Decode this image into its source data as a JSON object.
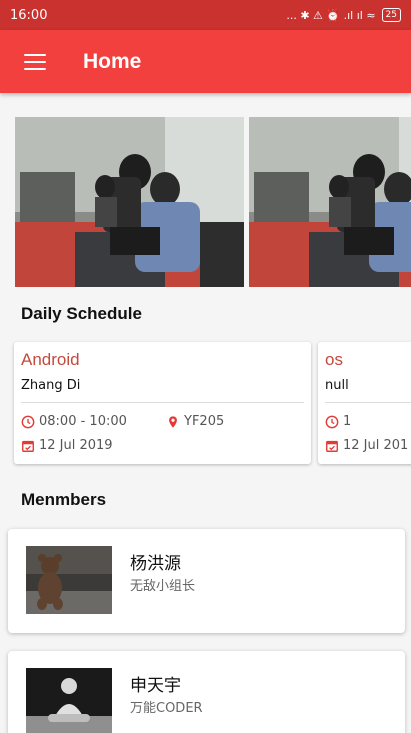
{
  "status_bar": {
    "time": "16:00",
    "indicators": "... ✱ ⚠ ⏰ .ıl ıl ≈",
    "battery": "25"
  },
  "app_bar": {
    "menu_icon": "hamburger-icon",
    "title": "Home"
  },
  "carousel": {
    "images": [
      {
        "description": "photo-two-men-at-laptop"
      },
      {
        "description": "photo-two-men-at-laptop"
      }
    ]
  },
  "schedule": {
    "title": "Daily Schedule",
    "cards": [
      {
        "subject": "Android",
        "teacher": "Zhang Di",
        "time": "08:00 - 10:00",
        "room": "YF205",
        "date": "12 Jul 2019"
      },
      {
        "subject": "os",
        "teacher": "null",
        "time": "1",
        "room": "",
        "date": "12 Jul 201"
      }
    ]
  },
  "members": {
    "title": "Menmbers",
    "items": [
      {
        "name": "杨洪源",
        "role": "无敌小组长",
        "avatar": "teddy-bear-photo"
      },
      {
        "name": "申天宇",
        "role": "万能CODER",
        "avatar": "sitting-figure-photo"
      }
    ]
  },
  "colors": {
    "app_bar": "#f2403f",
    "status_bar": "#c9322f",
    "accent": "#c44a3e",
    "icon_red": "#e53935"
  }
}
